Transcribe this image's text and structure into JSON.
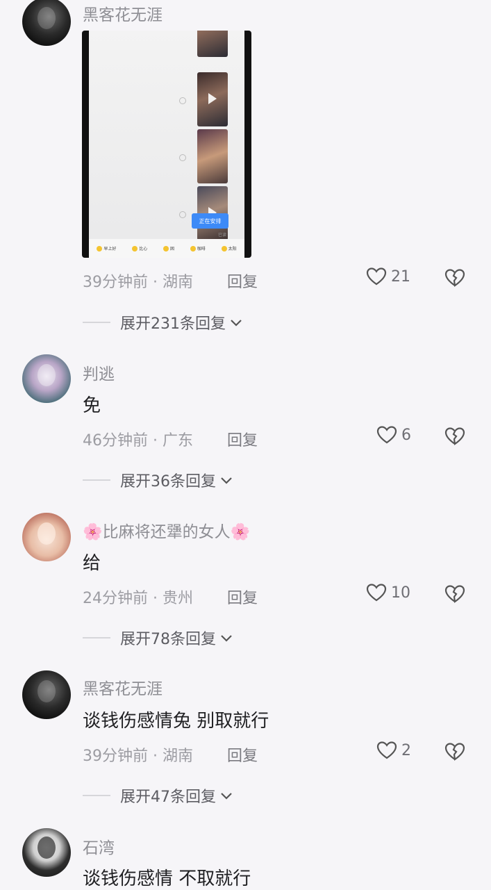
{
  "comments": [
    {
      "name": "黑客花无涯",
      "text": "",
      "time": "39分钟前 · 湖南",
      "reply": "回复",
      "likes": "21",
      "expand": "展开231条回复",
      "screenshot": {
        "button": "正在安排",
        "note": "已读",
        "bar": [
          "早上好",
          "比心",
          "困",
          "咖啡",
          "太阳"
        ]
      }
    },
    {
      "name": "判逃",
      "text": "免",
      "time": "46分钟前 · 广东",
      "reply": "回复",
      "likes": "6",
      "expand": "展开36条回复"
    },
    {
      "name": "🌸比麻将还犟的女人🌸",
      "text": "给",
      "time": "24分钟前 · 贵州",
      "reply": "回复",
      "likes": "10",
      "expand": "展开78条回复"
    },
    {
      "name": "黑客花无涯",
      "text": "谈钱伤感情兔 别取就行",
      "time": "39分钟前 · 湖南",
      "reply": "回复",
      "likes": "2",
      "expand": "展开47条回复"
    },
    {
      "name": "石湾",
      "text": "谈钱伤感情 不取就行"
    }
  ],
  "icons": {
    "like": "heart-outline-icon",
    "dislike": "broken-heart-icon",
    "expand": "chevron-down-icon"
  }
}
